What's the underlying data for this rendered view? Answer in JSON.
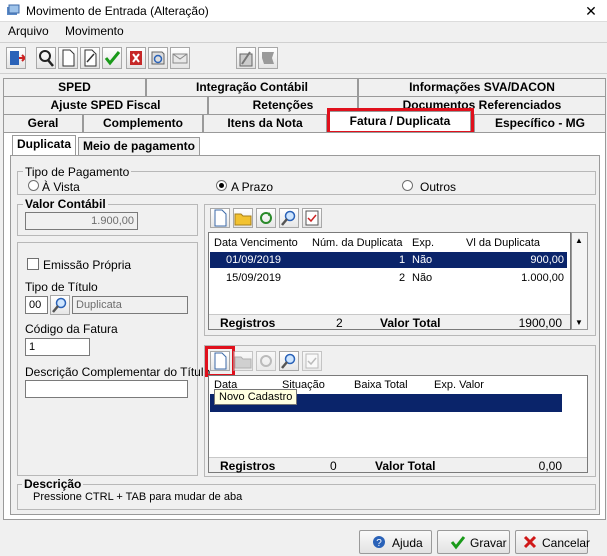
{
  "window": {
    "title": "Movimento de Entrada (Alteração)",
    "close": "✕"
  },
  "menu": [
    "Arquivo",
    "Movimento"
  ],
  "tabs": {
    "row1": [
      "SPED",
      "Integração Contábil",
      "Informações SVA/DACON"
    ],
    "row2": [
      "Ajuste SPED Fiscal",
      "Retenções",
      "Documentos Referenciados"
    ],
    "row3": [
      "Geral",
      "Complemento",
      "Itens da Nota",
      "Fatura / Duplicata",
      "Específico - MG"
    ],
    "inner": [
      "Duplicata",
      "Meio de pagamento"
    ]
  },
  "tipo_pagamento": {
    "legend": "Tipo de Pagamento",
    "options": [
      "À Vista",
      "A Prazo",
      "Outros"
    ],
    "selected": "A Prazo"
  },
  "valor_contabil": {
    "label": "Valor Contábil",
    "value": "1.900,00"
  },
  "emissao_propria": {
    "label": "Emissão Própria",
    "checked": false
  },
  "tipo_titulo": {
    "label": "Tipo de Título",
    "code": "00",
    "description": "Duplicata"
  },
  "codigo_fatura": {
    "label": "Código da Fatura",
    "value": "1"
  },
  "descricao_complementar": {
    "label": "Descrição Complementar do Título",
    "value": ""
  },
  "duplicatas": {
    "columns": [
      "Data Vencimento",
      "Núm. da Duplicata",
      "Exp.",
      "Vl da Duplicata"
    ],
    "rows": [
      [
        "01/09/2019",
        "1",
        "Não",
        "900,00"
      ],
      [
        "15/09/2019",
        "2",
        "Não",
        "1.000,00"
      ]
    ],
    "footer": {
      "registros_label": "Registros",
      "registros": "2",
      "total_label": "Valor Total",
      "total": "1900,00"
    }
  },
  "baixas": {
    "columns": [
      "Data",
      "Situação",
      "Baixa Total",
      "Exp. Valor"
    ],
    "footer": {
      "registros_label": "Registros",
      "registros": "0",
      "total_label": "Valor Total",
      "total": "0,00"
    }
  },
  "tooltip": "Novo Cadastro",
  "descricao": {
    "legend": "Descrição",
    "text": "Pressione CTRL + TAB para  mudar de aba"
  },
  "buttons": {
    "ajuda": "Ajuda",
    "gravar": "Gravar",
    "cancelar": "Cancelar"
  },
  "colors": {
    "selection": "#0a246a",
    "highlight": "#e0101c"
  }
}
